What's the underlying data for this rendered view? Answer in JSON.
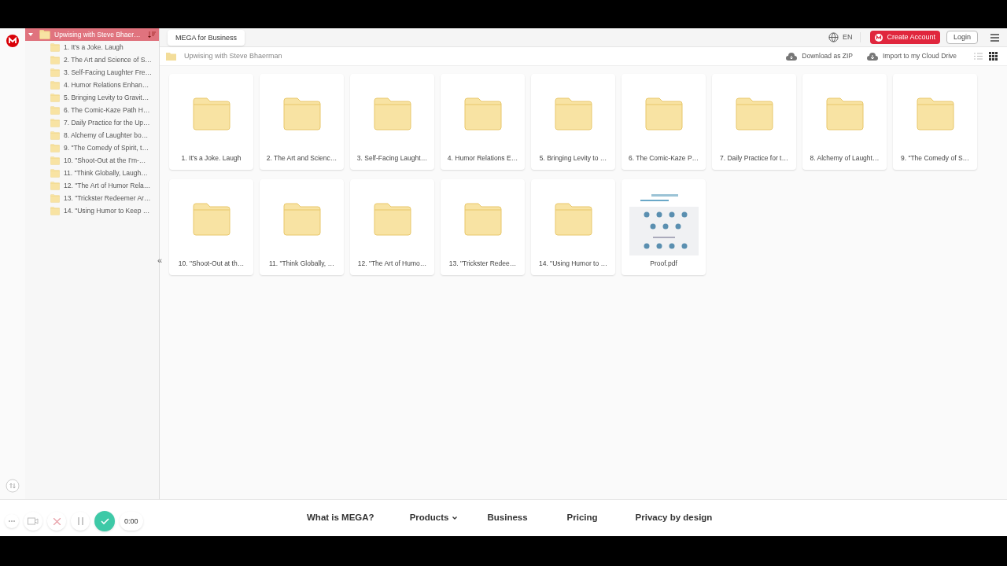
{
  "header": {
    "business_tab": "MEGA for Business",
    "language": "EN",
    "create_account": "Create Account",
    "login": "Login"
  },
  "breadcrumb": {
    "folder": "Upwising with Steve Bhaerman",
    "download": "Download as ZIP",
    "import": "Import to my Cloud Drive",
    "views": [
      {
        "kind": "list",
        "selected": false
      },
      {
        "kind": "grid",
        "selected": true
      }
    ]
  },
  "sidebar": {
    "collapse": "«",
    "root": {
      "label": "Upwising with Steve Bhaer…",
      "expanded": true,
      "selected": true,
      "children": [
        {
          "label": "1. It's a Joke. Laugh"
        },
        {
          "label": "2. The Art and Science of S…"
        },
        {
          "label": "3. Self-Facing Laughter Fre…"
        },
        {
          "label": "4. Humor Relations Enhan…"
        },
        {
          "label": "5. Bringing Levity to Gravit…"
        },
        {
          "label": "6. The Comic-Kaze Path H…"
        },
        {
          "label": "7. Daily Practice for the Up…"
        },
        {
          "label": "8. Alchemy of Laughter bo…"
        },
        {
          "label": "9. \"The Comedy of Spirit, t…"
        },
        {
          "label": "10. \"Shoot-Out at the I'm-…"
        },
        {
          "label": "11. \"Think Globally, Laugh…"
        },
        {
          "label": "12. \"The Art of Humor Rela…"
        },
        {
          "label": "13. \"Trickster Redeemer Ar…"
        },
        {
          "label": "14. \"Using Humor to Keep …"
        }
      ]
    }
  },
  "files": [
    {
      "kind": "folder",
      "name": "1. It's a Joke. Laugh"
    },
    {
      "kind": "folder",
      "name": "2. The Art and Scienc…"
    },
    {
      "kind": "folder",
      "name": "3. Self-Facing Laught…"
    },
    {
      "kind": "folder",
      "name": "4. Humor Relations E…"
    },
    {
      "kind": "folder",
      "name": "5. Bringing Levity to …"
    },
    {
      "kind": "folder",
      "name": "6. The Comic-Kaze P…"
    },
    {
      "kind": "folder",
      "name": "7. Daily Practice for t…"
    },
    {
      "kind": "folder",
      "name": "8. Alchemy of Laught…"
    },
    {
      "kind": "folder",
      "name": "9. \"The Comedy of S…"
    },
    {
      "kind": "folder",
      "name": "10. \"Shoot-Out at th…"
    },
    {
      "kind": "folder",
      "name": "11. \"Think Globally, …"
    },
    {
      "kind": "folder",
      "name": "12. \"The Art of Humo…"
    },
    {
      "kind": "folder",
      "name": "13. \"Trickster Redee…"
    },
    {
      "kind": "folder",
      "name": "14. \"Using Humor to …"
    },
    {
      "kind": "pdf",
      "name": "Proof.pdf"
    }
  ],
  "footer_nav": [
    {
      "label": "What is MEGA?",
      "dropdown": false
    },
    {
      "label": "Products",
      "dropdown": true
    },
    {
      "label": "Business",
      "dropdown": false
    },
    {
      "label": "Pricing",
      "dropdown": false
    },
    {
      "label": "Privacy by design",
      "dropdown": false
    }
  ],
  "recorder": {
    "timer": "0:00"
  }
}
